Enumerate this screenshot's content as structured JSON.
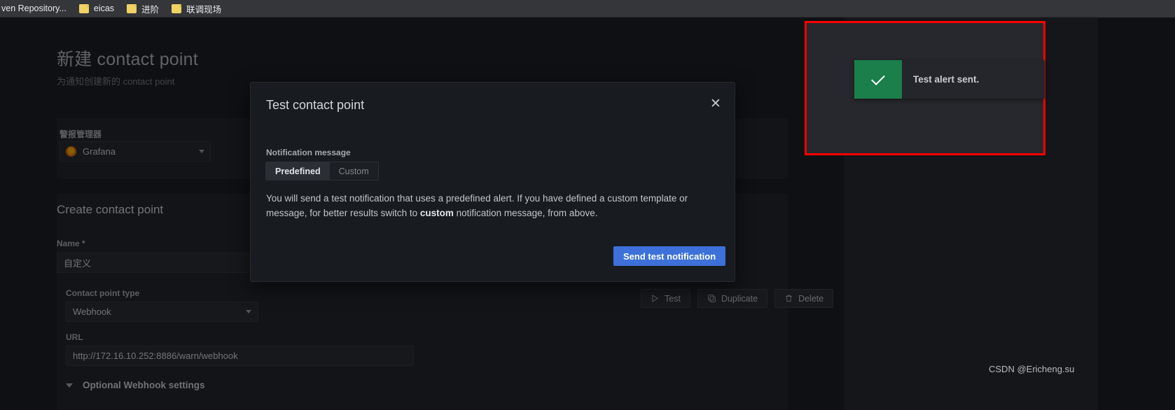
{
  "browser": {
    "bookmarks": [
      {
        "label": "ven Repository...",
        "icon": "folder-icon",
        "has_icon": false
      },
      {
        "label": "eicas",
        "icon": "folder-icon",
        "has_icon": true
      },
      {
        "label": "进阶",
        "icon": "folder-icon",
        "has_icon": true
      },
      {
        "label": "联调现场",
        "icon": "folder-icon",
        "has_icon": true
      }
    ]
  },
  "page": {
    "title": "新建 contact point",
    "subtitle": "为通知创建新的 contact point"
  },
  "alertmanager": {
    "label": "警报管理器",
    "selected": "Grafana",
    "logo_icon": "grafana-logo-icon",
    "chevron_icon": "chevron-down-icon"
  },
  "form": {
    "heading": "Create contact point",
    "name_label": "Name *",
    "name_value": "自定义",
    "type_label": "Contact point type",
    "type_value": "Webhook",
    "url_label": "URL",
    "url_value": "http://172.16.10.252:8886/warn/webhook",
    "optional_settings": "Optional Webhook settings"
  },
  "actions": [
    {
      "label": "Test",
      "icon": "play-icon"
    },
    {
      "label": "Duplicate",
      "icon": "copy-icon"
    },
    {
      "label": "Delete",
      "icon": "trash-icon"
    }
  ],
  "modal": {
    "title": "Test contact point",
    "close_icon": "close-icon",
    "section_label": "Notification message",
    "options": [
      {
        "label": "Predefined",
        "selected": true
      },
      {
        "label": "Custom",
        "selected": false
      }
    ],
    "body_part1": "You will send a test notification that uses a predefined alert. If you have defined a custom template or message, for better results switch to ",
    "body_bold": "custom",
    "body_part2": " notification message, from above.",
    "primary_button": "Send test notification"
  },
  "toast": {
    "message": "Test alert sent.",
    "icon": "check-icon",
    "accent_color": "#1a7f4b",
    "highlight_color": "#fe0000"
  },
  "watermark": "CSDN @Ericheng.su"
}
